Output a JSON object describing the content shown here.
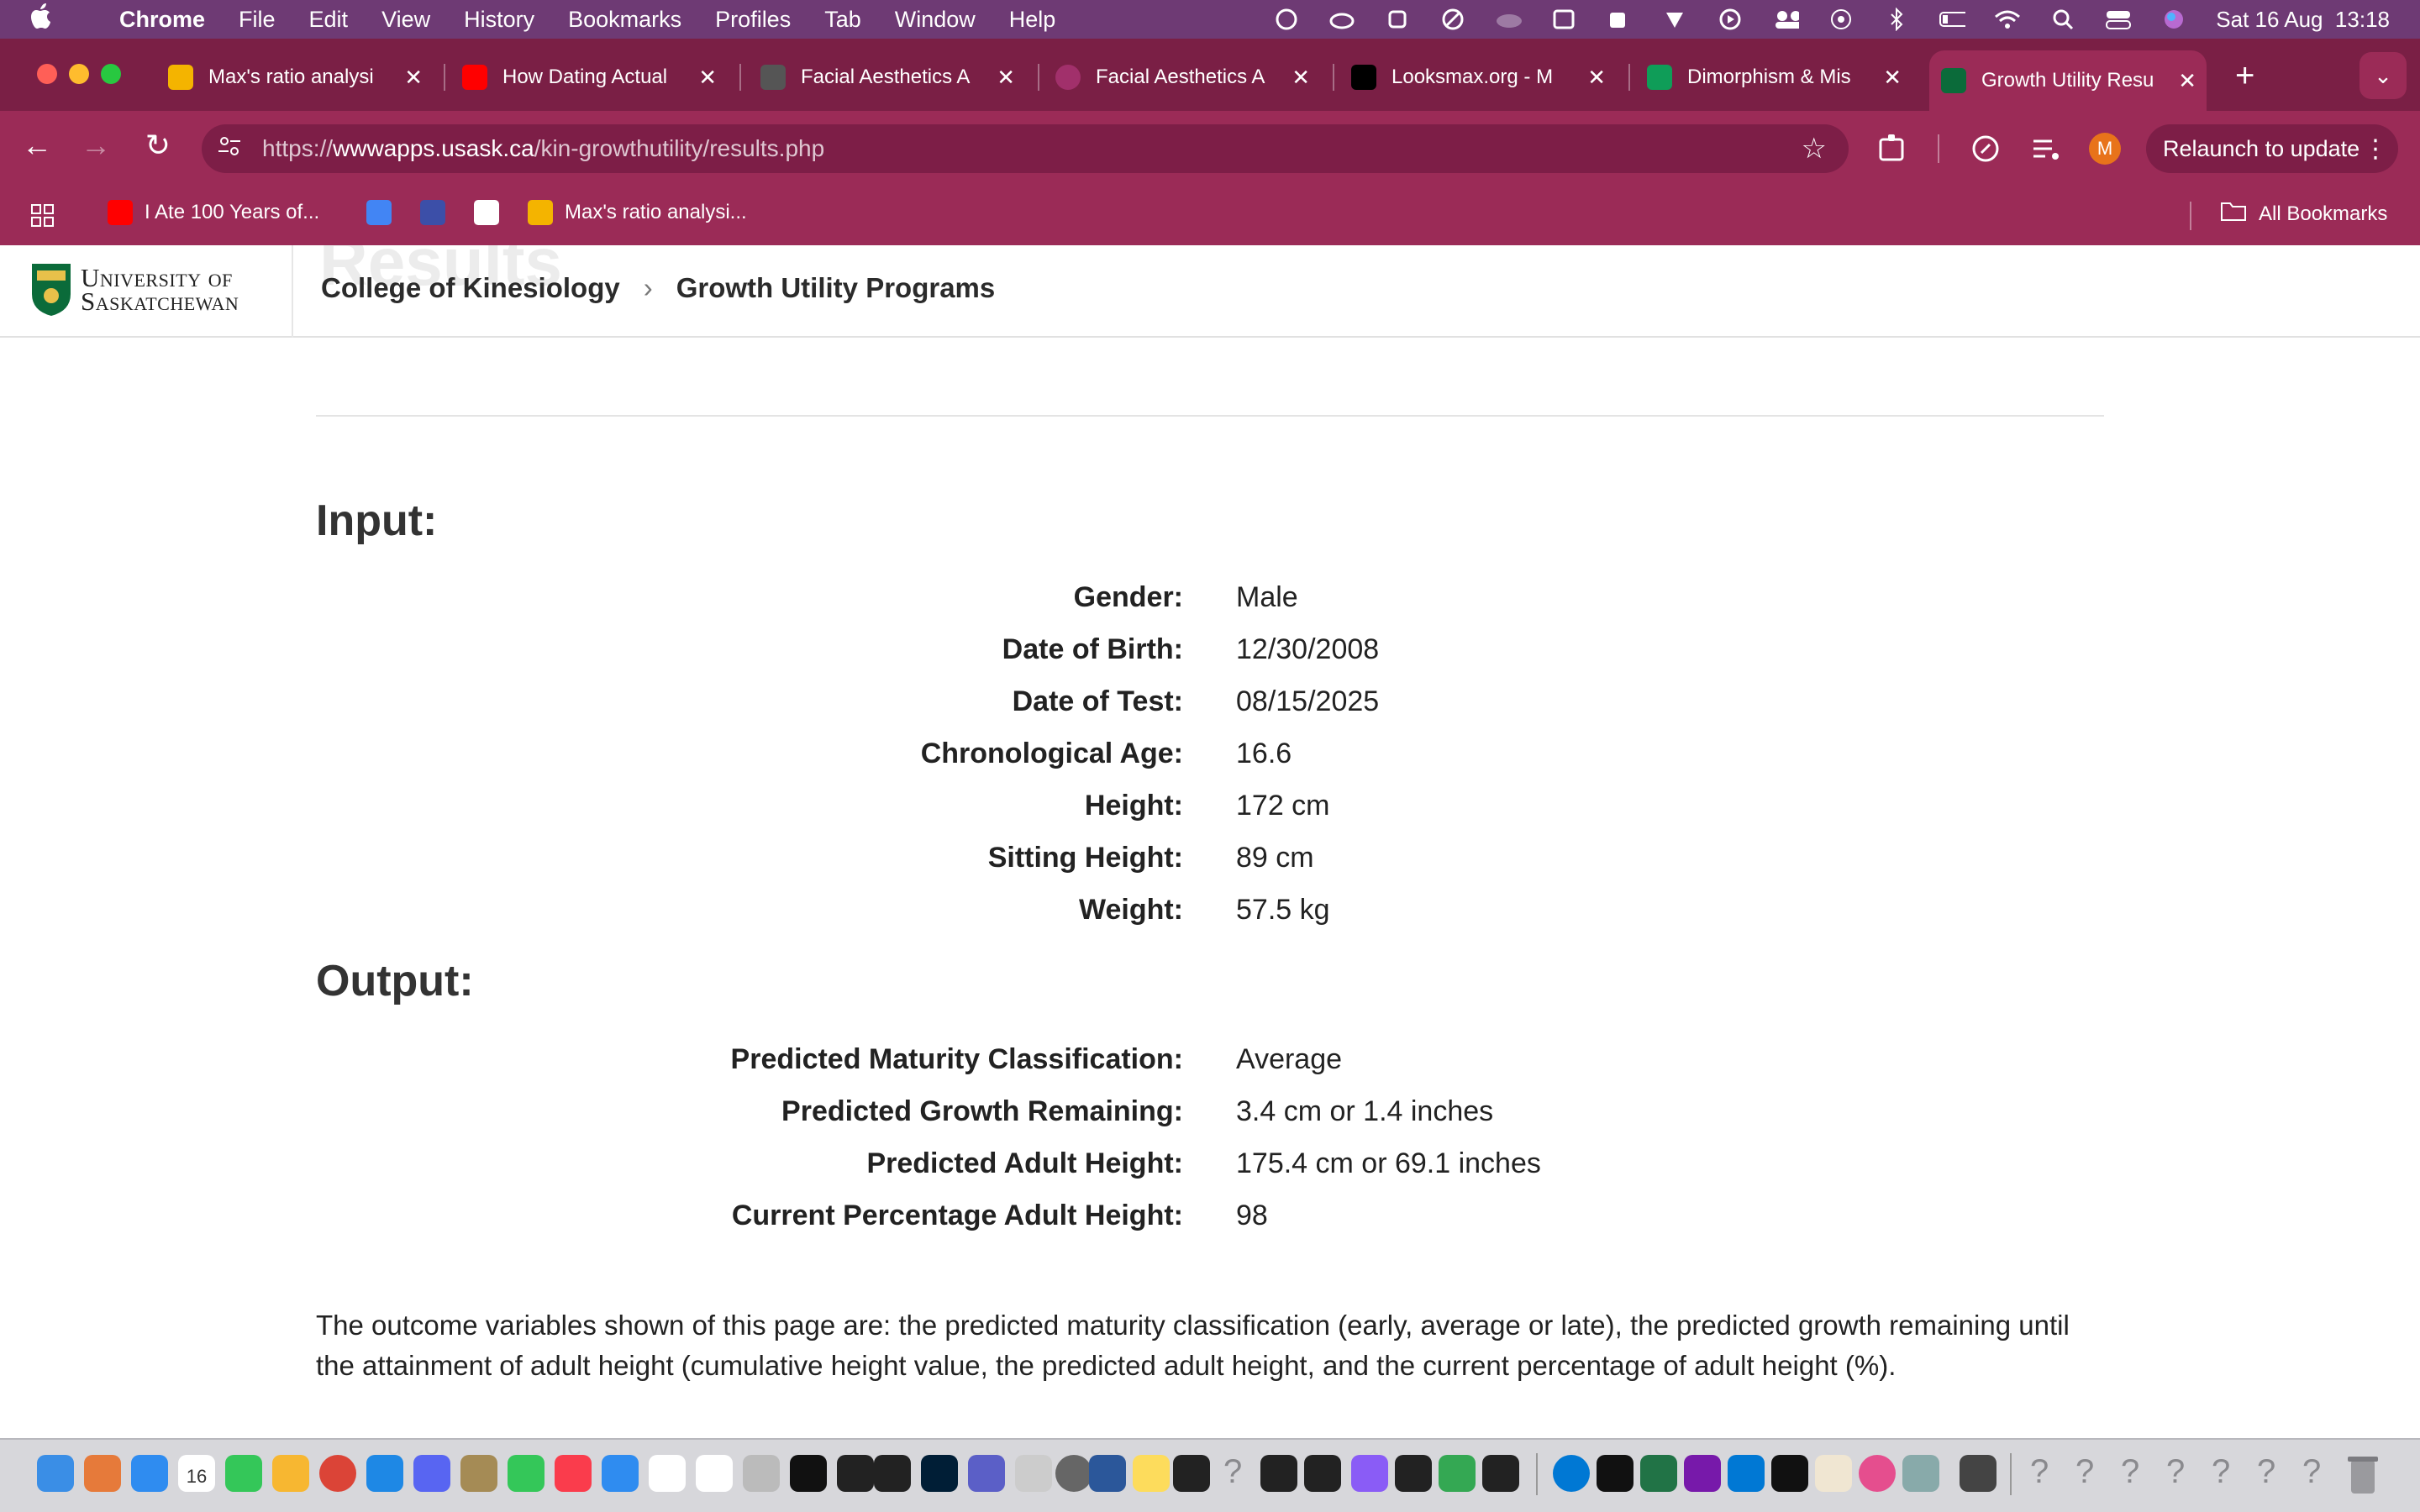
{
  "menubar": {
    "app": "Chrome",
    "items": [
      "File",
      "Edit",
      "View",
      "History",
      "Bookmarks",
      "Profiles",
      "Tab",
      "Window",
      "Help"
    ],
    "clock": "Sat 16 Aug  13:18"
  },
  "tabs": [
    {
      "title": "Max's ratio analysi",
      "favicon_color": "#f4b400"
    },
    {
      "title": "How Dating Actual",
      "favicon_color": "#ff0000"
    },
    {
      "title": "Facial Aesthetics A",
      "favicon_color": "#555555"
    },
    {
      "title": "Facial Aesthetics A",
      "favicon_color": "#a1306b"
    },
    {
      "title": "Looksmax.org - M",
      "favicon_color": "#000000"
    },
    {
      "title": "Dimorphism & Mis",
      "favicon_color": "#0f9d58"
    },
    {
      "title": "Growth Utility Resu",
      "favicon_color": "#0b6b3a",
      "active": true
    }
  ],
  "toolbar": {
    "url_prefix": "https://",
    "url_host": "wwwapps.usask.ca",
    "url_path": "/kin-growthutility/results.php",
    "profile_initial": "M",
    "relaunch_label": "Relaunch to update"
  },
  "bookmarks": {
    "items": [
      {
        "label": "I Ate 100 Years of...",
        "color": "#ff0000"
      },
      {
        "label": "",
        "color": "#4285f4"
      },
      {
        "label": "",
        "color": "#3c4fa8"
      },
      {
        "label": "",
        "color": "#ffffff"
      },
      {
        "label": "Max's ratio analysi...",
        "color": "#f4b400"
      }
    ],
    "all_bookmarks": "All Bookmarks"
  },
  "site": {
    "ghost_title": "Results",
    "logo_line1": "University of",
    "logo_line2": "Saskatchewan",
    "breadcrumb": [
      "College of Kinesiology",
      "Growth Utility Programs"
    ]
  },
  "input": {
    "title": "Input:",
    "rows": [
      {
        "label": "Gender:",
        "value": "Male"
      },
      {
        "label": "Date of Birth:",
        "value": "12/30/2008"
      },
      {
        "label": "Date of Test:",
        "value": "08/15/2025"
      },
      {
        "label": "Chronological Age:",
        "value": "16.6"
      },
      {
        "label": "Height:",
        "value": "172 cm"
      },
      {
        "label": "Sitting Height:",
        "value": "89 cm"
      },
      {
        "label": "Weight:",
        "value": "57.5 kg"
      }
    ]
  },
  "output": {
    "title": "Output:",
    "rows": [
      {
        "label": "Predicted Maturity Classification:",
        "value": "Average"
      },
      {
        "label": "Predicted Growth Remaining:",
        "value": "3.4 cm or 1.4 inches"
      },
      {
        "label": "Predicted Adult Height:",
        "value": "175.4 cm or 69.1 inches"
      },
      {
        "label": "Current Percentage Adult Height:",
        "value": "98"
      }
    ]
  },
  "description": "The outcome variables shown of this page are: the predicted maturity classification (early, average or late), the predicted growth remaining until the attainment of adult height (cumulative height value, the predicted adult height, and the current percentage of adult height (%).",
  "dock": {
    "calendar_day": "16"
  }
}
